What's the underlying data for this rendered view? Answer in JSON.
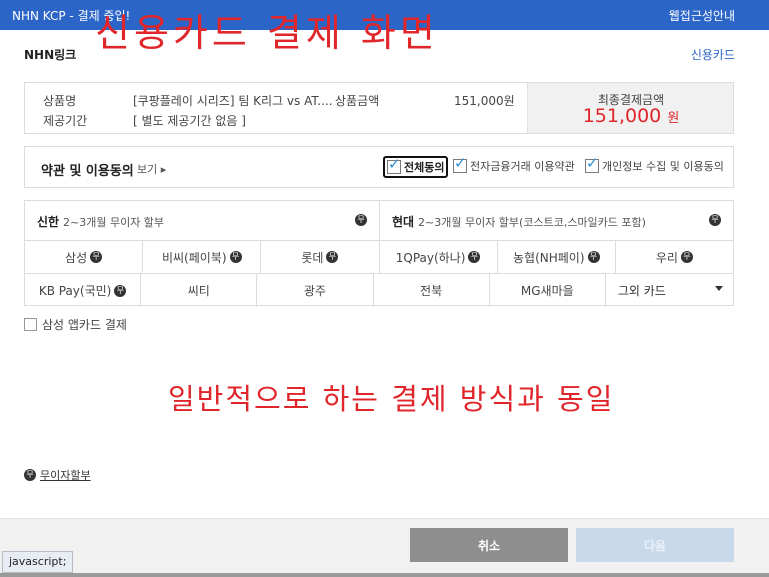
{
  "overlay": {
    "title": "신용카드 결제 화면",
    "subtitle": "일반적으로 하는 결제 방식과 동일",
    "color": "#e0262b"
  },
  "header": {
    "title": "NHN KCP - 결제 중입!",
    "accessibility": "웹접근성안내",
    "color": "#2b65c8"
  },
  "merchant": "NHN링크",
  "pay_method": "신용카드",
  "summary": {
    "product_label": "상품명",
    "product_value": "[쿠팡플레이 시리즈] 팀 K리그 vs AT....",
    "amount_label": "상품금액",
    "amount_value": "151,000원",
    "period_label": "제공기간",
    "period_value": "[ 별도 제공기간 없음 ]",
    "total_label": "최종결제금액",
    "total_value": "151,000",
    "total_unit": "원"
  },
  "terms": {
    "title": "약관 및 이용동의",
    "view_more": "보기 ▸",
    "agree_all": "전체동의",
    "agree_ecommerce": "전자금융거래 이용약관",
    "agree_privacy": "개인정보 수집 및 이용동의"
  },
  "cards": {
    "shinhan": {
      "name": "신한",
      "desc": "2~3개월 무이자 할부"
    },
    "hyundai": {
      "name": "현대",
      "desc": "2~3개월 무이자 할부(코스트코,스마일카드 포함)"
    },
    "row2": [
      "삼성",
      "비씨(페이북)",
      "롯데",
      "1QPay(하나)",
      "농협(NH페이)",
      "우리"
    ],
    "row3": [
      "KB Pay(국민)",
      "씨티",
      "광주",
      "전북",
      "MG새마을",
      "그외 카드"
    ],
    "badge": "무"
  },
  "samsung_app": "삼성 앱카드 결제",
  "no_interest_link": "무이자할부",
  "footer": {
    "cancel": "취소",
    "next": "다음"
  },
  "status_bar": "javascript;"
}
